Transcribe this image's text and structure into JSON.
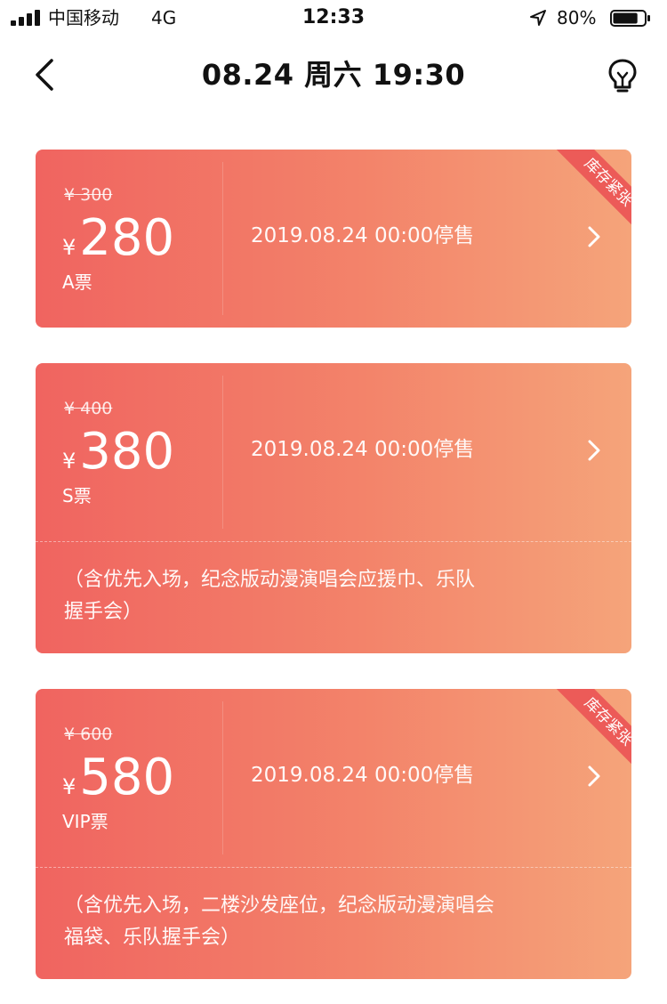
{
  "status_bar": {
    "carrier": "中国移动",
    "network": "4G",
    "time": "12:33",
    "battery_percent": "80%",
    "battery_level": 0.8
  },
  "nav": {
    "title": "08.24 周六 19:30",
    "back_icon": "chevron-left-icon",
    "right_icon": "lightbulb-icon"
  },
  "tickets": [
    {
      "original_price": "¥ 300",
      "currency_symbol": "¥",
      "price": "280",
      "name": "A票",
      "deadline": "2019.08.24 00:00停售",
      "badge": "库存紧张"
    },
    {
      "original_price": "¥ 400",
      "currency_symbol": "¥",
      "price": "380",
      "name": "S票",
      "deadline": "2019.08.24 00:00停售",
      "benefits_line1": "（含优先入场，纪念版动漫演唱会应援巾、乐队",
      "benefits_line2": "握手会）"
    },
    {
      "original_price": "¥ 600",
      "currency_symbol": "¥",
      "price": "580",
      "name": "VIP票",
      "deadline": "2019.08.24 00:00停售",
      "badge": "库存紧张",
      "benefits_line1": "（含优先入场，二楼沙发座位，纪念版动漫演唱会",
      "benefits_line2": "福袋、乐队握手会）"
    }
  ],
  "colors": {
    "card_start": "#f06460",
    "card_end": "#f5a47a",
    "ribbon": "#ec5b58"
  }
}
